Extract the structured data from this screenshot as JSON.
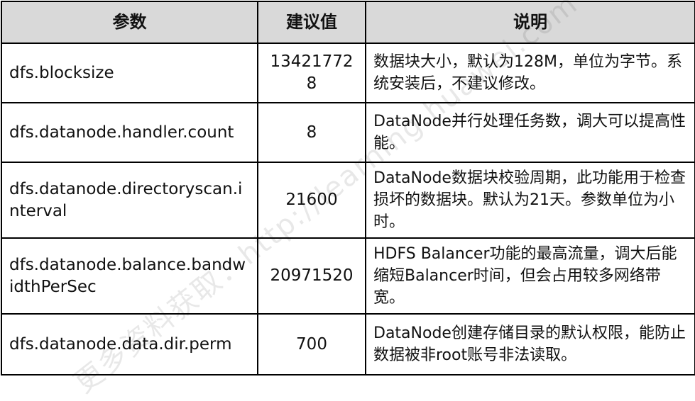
{
  "headers": [
    "参数",
    "建议值",
    "说明"
  ],
  "rows": [
    {
      "param": "dfs.blocksize",
      "value": "134217728",
      "desc": "数据块大小，默认为128M，单位为字节。系统安装后，不建议修改。"
    },
    {
      "param": "dfs.datanode.handler.count",
      "value": "8",
      "desc": "DataNode并行处理任务数，调大可以提高性能。"
    },
    {
      "param": "dfs.datanode.directoryscan.interval",
      "value": "21600",
      "desc": "DataNode数据块校验周期，此功能用于检查损坏的数据块。默认为21天。参数单位为小时。"
    },
    {
      "param": "dfs.datanode.balance.bandwidthPerSec",
      "value": "20971520",
      "desc": "HDFS Balancer功能的最高流量，调大后能缩短Balancer时间，但会占用较多网络带宽。"
    },
    {
      "param": "dfs.datanode.data.dir.perm",
      "value": "700",
      "desc": "DataNode创建存储目录的默认权限，能防止数据被非root账号非法读取。"
    }
  ],
  "watermark": "更多资料获取：http://learning.huawei.com"
}
